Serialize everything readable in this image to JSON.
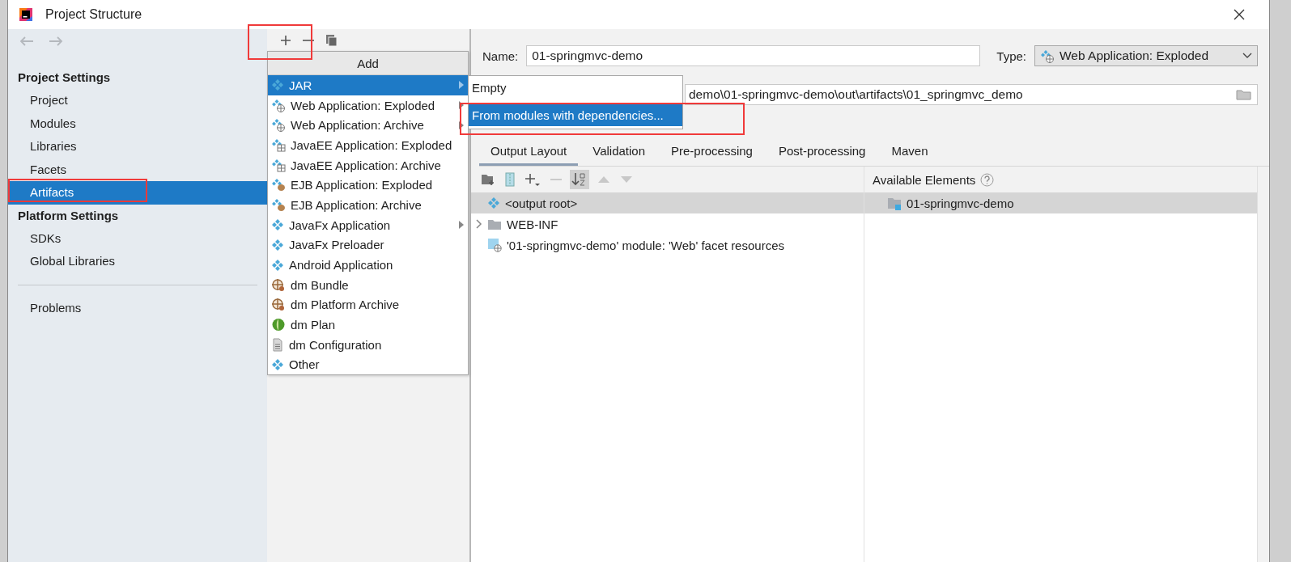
{
  "window": {
    "title": "Project Structure"
  },
  "sidebar": {
    "sections": [
      {
        "heading": "Project Settings",
        "items": [
          {
            "label": "Project",
            "selected": false
          },
          {
            "label": "Modules",
            "selected": false
          },
          {
            "label": "Libraries",
            "selected": false
          },
          {
            "label": "Facets",
            "selected": false
          },
          {
            "label": "Artifacts",
            "selected": true
          }
        ]
      },
      {
        "heading": "Platform Settings",
        "items": [
          {
            "label": "SDKs",
            "selected": false
          },
          {
            "label": "Global Libraries",
            "selected": false
          }
        ]
      }
    ],
    "extra_items": [
      {
        "label": "Problems",
        "selected": false
      }
    ]
  },
  "add_menu": {
    "title": "Add",
    "items": [
      {
        "label": "JAR",
        "kind": "artifact",
        "has_submenu": true,
        "selected": true
      },
      {
        "label": "Web Application: Exploded",
        "kind": "web",
        "has_submenu": true,
        "selected": false
      },
      {
        "label": "Web Application: Archive",
        "kind": "web",
        "has_submenu": true,
        "selected": false
      },
      {
        "label": "JavaEE Application: Exploded",
        "kind": "javaee",
        "has_submenu": false,
        "selected": false
      },
      {
        "label": "JavaEE Application: Archive",
        "kind": "javaee",
        "has_submenu": false,
        "selected": false
      },
      {
        "label": "EJB Application: Exploded",
        "kind": "ejb",
        "has_submenu": false,
        "selected": false
      },
      {
        "label": "EJB Application: Archive",
        "kind": "ejb",
        "has_submenu": false,
        "selected": false
      },
      {
        "label": "JavaFx Application",
        "kind": "artifact",
        "has_submenu": true,
        "selected": false
      },
      {
        "label": "JavaFx Preloader",
        "kind": "artifact",
        "has_submenu": false,
        "selected": false
      },
      {
        "label": "Android Application",
        "kind": "artifact",
        "has_submenu": false,
        "selected": false
      },
      {
        "label": "dm Bundle",
        "kind": "bundle",
        "has_submenu": false,
        "selected": false
      },
      {
        "label": "dm Platform Archive",
        "kind": "bundle",
        "has_submenu": false,
        "selected": false
      },
      {
        "label": "dm Plan",
        "kind": "plan",
        "has_submenu": false,
        "selected": false
      },
      {
        "label": "dm Configuration",
        "kind": "config",
        "has_submenu": false,
        "selected": false
      },
      {
        "label": "Other",
        "kind": "artifact",
        "has_submenu": false,
        "selected": false
      }
    ]
  },
  "submenu": {
    "items": [
      {
        "label": "Empty",
        "selected": false
      },
      {
        "label": "From modules with dependencies...",
        "selected": true
      }
    ]
  },
  "artifact": {
    "name_label": "Name:",
    "name": "01-springmvc-demo",
    "type_label": "Type:",
    "type": "Web Application: Exploded",
    "output_path": "demo\\01-springmvc-demo\\out\\artifacts\\01_springmvc_demo"
  },
  "tabs": [
    {
      "label": "Output Layout",
      "selected": true
    },
    {
      "label": "Validation",
      "selected": false
    },
    {
      "label": "Pre-processing",
      "selected": false
    },
    {
      "label": "Post-processing",
      "selected": false
    },
    {
      "label": "Maven",
      "selected": false
    }
  ],
  "layout_tree": [
    {
      "label": "<output root>",
      "kind": "root",
      "selected": true,
      "children": [
        {
          "label": "WEB-INF",
          "kind": "folder",
          "expanded": false
        },
        {
          "label": "'01-springmvc-demo' module: 'Web' facet resources",
          "kind": "facet"
        }
      ]
    }
  ],
  "available": {
    "title": "Available Elements",
    "items": [
      {
        "label": "01-springmvc-demo",
        "selected": true
      }
    ]
  }
}
